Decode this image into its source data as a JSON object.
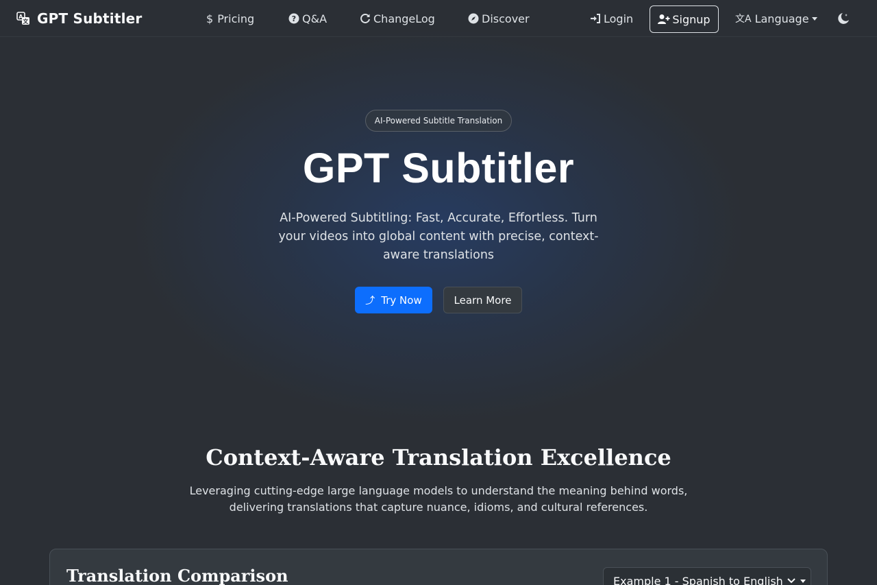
{
  "navbar": {
    "brand": "GPT Subtitler",
    "links": {
      "pricing": "Pricing",
      "qa": "Q&A",
      "changelog": "ChangeLog",
      "discover": "Discover"
    },
    "login": "Login",
    "signup": "Signup",
    "language": "Language"
  },
  "hero": {
    "badge": "AI-Powered Subtitle Translation",
    "title": "GPT Subtitler",
    "subtitle": "AI-Powered Subtitling: Fast, Accurate, Effortless. Turn your videos into global content with precise, context-aware translations",
    "try_now": "Try Now",
    "learn_more": "Learn More"
  },
  "features": {
    "title": "Context-Aware Translation Excellence",
    "description": "Leveraging cutting-edge large language models to understand the meaning behind words, delivering translations that capture nuance, idioms, and cultural references."
  },
  "comparison": {
    "title": "Translation Comparison",
    "selected_example": "Example 1 - Spanish to English"
  },
  "icons": {
    "logo": "translate-logo-icon",
    "pricing": "dollar-icon",
    "qa": "question-circle-icon",
    "changelog": "refresh-icon",
    "discover": "compass-icon",
    "login": "sign-in-icon",
    "signup": "user-plus-icon",
    "language": "translate-icon",
    "theme": "moon-stars-icon",
    "try_now": "upload-arrow-icon"
  },
  "colors": {
    "background": "#2b2f35",
    "primary": "#0d6efd",
    "card": "#343a40"
  }
}
